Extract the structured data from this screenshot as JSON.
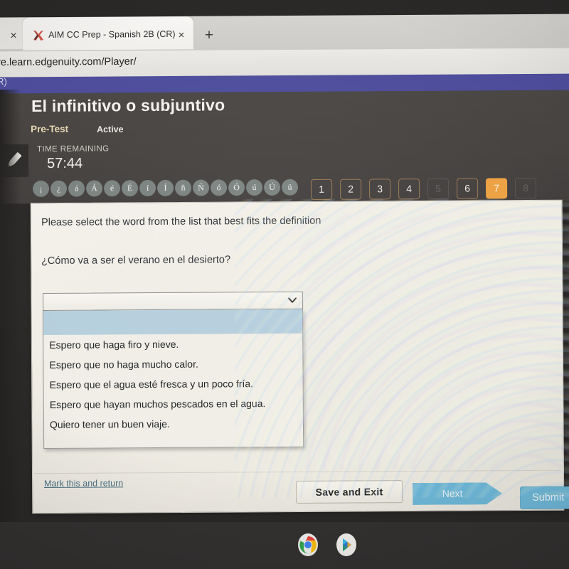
{
  "browser": {
    "ghost_tab_close_icon": "×",
    "active_tab": {
      "favicon_name": "aim-x-favicon",
      "title": "AIM CC Prep - Spanish 2B (CR)",
      "close_icon": "×"
    },
    "new_tab_icon": "+",
    "url": "re.learn.edgenuity.com/Player/",
    "purple_band_text": "R)"
  },
  "header": {
    "lesson_title": "El infinitivo o subjuntivo",
    "assignment_type": "Pre-Test",
    "status": "Active",
    "pencil_tool_icon": "pencil-icon",
    "time_remaining_label": "TIME REMAINING",
    "time_remaining_value": "57:44",
    "accent_keys": [
      "¡",
      "¿",
      "á",
      "Á",
      "é",
      "É",
      "í",
      "Í",
      "ñ",
      "Ñ",
      "ó",
      "Ó",
      "ú",
      "Ú",
      "ü"
    ],
    "question_nav": [
      {
        "label": "1",
        "state": "available"
      },
      {
        "label": "2",
        "state": "available"
      },
      {
        "label": "3",
        "state": "available"
      },
      {
        "label": "4",
        "state": "available"
      },
      {
        "label": "5",
        "state": "disabled"
      },
      {
        "label": "6",
        "state": "available"
      },
      {
        "label": "7",
        "state": "current"
      },
      {
        "label": "8",
        "state": "disabled"
      }
    ]
  },
  "question": {
    "instruction": "Please select the word from the list that best fits the definition",
    "prompt": "¿Cómo va a ser el verano en el desierto?",
    "select_value": "",
    "select_caret_icon": "chevron-down-icon",
    "options": [
      "",
      "Espero que haga firo y nieve.",
      "Espero que no haga mucho calor.",
      "Espero que el agua esté fresca y un poco fría.",
      "Espero que hayan muchos pescados en el agua.",
      "Quiero tener un buen viaje."
    ],
    "selected_index": 0
  },
  "footer": {
    "mark_and_return": "Mark this and return",
    "save_and_exit": "Save and Exit",
    "next": "Next",
    "submit": "Submit"
  },
  "taskbar": {
    "chrome_icon": "chrome-icon",
    "play_store_icon": "google-play-icon"
  },
  "colors": {
    "accent_orange": "#eda143",
    "brand_purple": "#4d4d9c",
    "button_blue": "#6fb9d9",
    "header_dark": "#474341",
    "card_cream": "#efece4",
    "option_highlight": "#b6cfdd"
  }
}
